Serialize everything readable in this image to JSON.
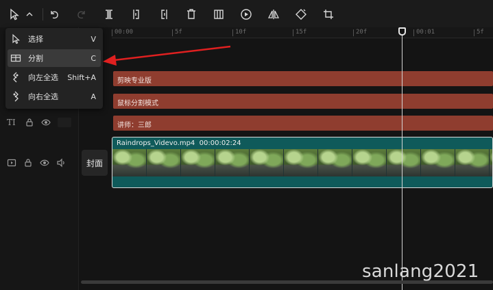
{
  "toolbar": {
    "icons": [
      "select-cursor-icon",
      "chevron-down-icon",
      "undo-icon",
      "redo-icon",
      "split-icon",
      "split-left-icon",
      "split-right-icon",
      "delete-icon",
      "freeze-frame-icon",
      "reverse-play-icon",
      "mirror-icon",
      "rotate-icon",
      "crop-icon"
    ]
  },
  "menu": {
    "items": [
      {
        "label": "选择",
        "shortcut": "V",
        "icon": "cursor-icon"
      },
      {
        "label": "分割",
        "shortcut": "C",
        "icon": "split-icon"
      },
      {
        "label": "向左全选",
        "shortcut": "Shift+A",
        "icon": "select-left-icon"
      },
      {
        "label": "向右全选",
        "shortcut": "A",
        "icon": "select-right-icon"
      }
    ]
  },
  "ruler": {
    "ticks": [
      "00:00",
      "5f",
      "10f",
      "15f",
      "20f",
      "00:01",
      "5f"
    ]
  },
  "tracks": {
    "text_clips": [
      "剪映专业版",
      "鼠标分割模式",
      "讲师：三郎"
    ],
    "text_track_label": "TI",
    "video_clip": {
      "name": "Raindrops_Videvo.mp4",
      "duration": "00:00:02:24"
    },
    "cover_label": "封面"
  },
  "watermark": "sanlang2021",
  "colors": {
    "text_clip": "#8f3d2f",
    "video_clip": "#0f5a5a",
    "arrow": "#e02020"
  }
}
